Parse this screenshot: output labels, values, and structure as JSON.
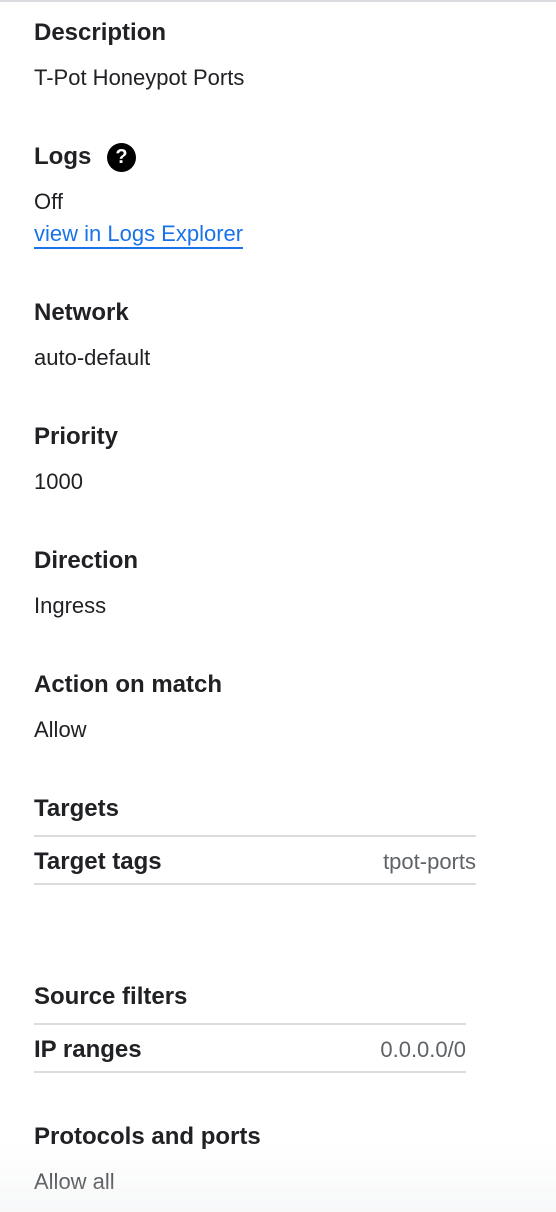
{
  "description": {
    "label": "Description",
    "value": "T-Pot Honeypot Ports"
  },
  "logs": {
    "label": "Logs",
    "help_icon": "help-circle-icon",
    "help_glyph": "?",
    "value": "Off",
    "link": "view in Logs Explorer"
  },
  "network": {
    "label": "Network",
    "value": "auto-default"
  },
  "priority": {
    "label": "Priority",
    "value": "1000"
  },
  "direction": {
    "label": "Direction",
    "value": "Ingress"
  },
  "action": {
    "label": "Action on match",
    "value": "Allow"
  },
  "targets": {
    "label": "Targets",
    "row_label": "Target tags",
    "row_value": "tpot-ports"
  },
  "source_filters": {
    "label": "Source filters",
    "row_label": "IP ranges",
    "row_value": "0.0.0.0/0"
  },
  "protocols": {
    "label": "Protocols and ports",
    "value": "Allow all"
  },
  "colors": {
    "text": "#202124",
    "link": "#1a73e8",
    "muted": "#5f6368",
    "divider": "#dadce0"
  }
}
